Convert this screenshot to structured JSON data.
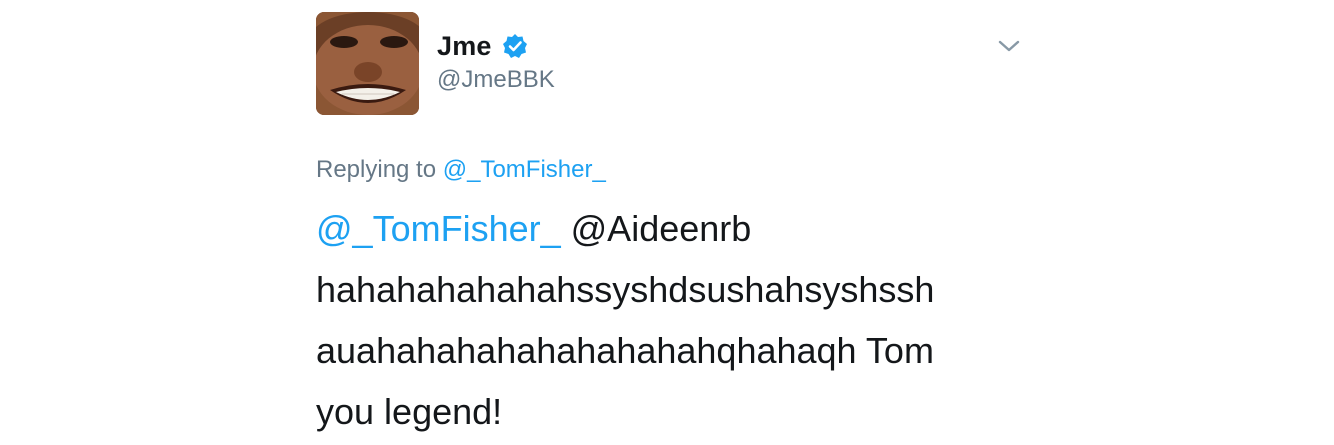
{
  "author": {
    "display_name": "Jme",
    "handle": "@JmeBBK",
    "verified": true
  },
  "replying": {
    "prefix": "Replying to",
    "mention": "@_TomFisher_"
  },
  "tweet": {
    "mention_1": "@_TomFisher_",
    "mention_2_text": "@Aideenrb",
    "line_2": "hahahahahahahssyshdsushahsyshssh",
    "line_3": "auahahahahahahahahahqhahaqh Tom",
    "line_4": "you legend!"
  },
  "colors": {
    "link": "#1da1f2",
    "secondary_text": "#657786",
    "primary_text": "#14171a"
  },
  "icons": {
    "verified": "verified-badge-icon",
    "menu": "chevron-down-icon"
  }
}
